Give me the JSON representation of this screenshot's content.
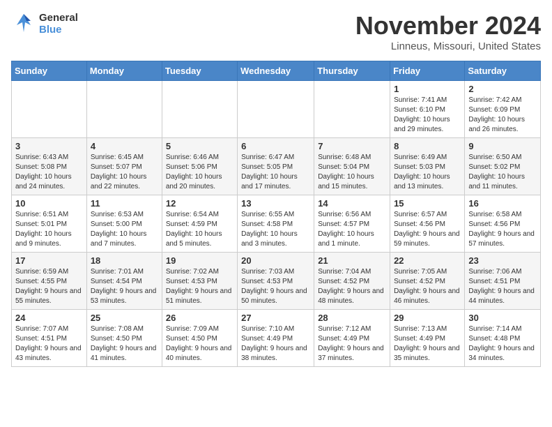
{
  "header": {
    "logo_general": "General",
    "logo_blue": "Blue",
    "month": "November 2024",
    "location": "Linneus, Missouri, United States"
  },
  "weekdays": [
    "Sunday",
    "Monday",
    "Tuesday",
    "Wednesday",
    "Thursday",
    "Friday",
    "Saturday"
  ],
  "weeks": [
    [
      {
        "day": "",
        "info": ""
      },
      {
        "day": "",
        "info": ""
      },
      {
        "day": "",
        "info": ""
      },
      {
        "day": "",
        "info": ""
      },
      {
        "day": "",
        "info": ""
      },
      {
        "day": "1",
        "info": "Sunrise: 7:41 AM\nSunset: 6:10 PM\nDaylight: 10 hours and 29 minutes."
      },
      {
        "day": "2",
        "info": "Sunrise: 7:42 AM\nSunset: 6:09 PM\nDaylight: 10 hours and 26 minutes."
      }
    ],
    [
      {
        "day": "3",
        "info": "Sunrise: 6:43 AM\nSunset: 5:08 PM\nDaylight: 10 hours and 24 minutes."
      },
      {
        "day": "4",
        "info": "Sunrise: 6:45 AM\nSunset: 5:07 PM\nDaylight: 10 hours and 22 minutes."
      },
      {
        "day": "5",
        "info": "Sunrise: 6:46 AM\nSunset: 5:06 PM\nDaylight: 10 hours and 20 minutes."
      },
      {
        "day": "6",
        "info": "Sunrise: 6:47 AM\nSunset: 5:05 PM\nDaylight: 10 hours and 17 minutes."
      },
      {
        "day": "7",
        "info": "Sunrise: 6:48 AM\nSunset: 5:04 PM\nDaylight: 10 hours and 15 minutes."
      },
      {
        "day": "8",
        "info": "Sunrise: 6:49 AM\nSunset: 5:03 PM\nDaylight: 10 hours and 13 minutes."
      },
      {
        "day": "9",
        "info": "Sunrise: 6:50 AM\nSunset: 5:02 PM\nDaylight: 10 hours and 11 minutes."
      }
    ],
    [
      {
        "day": "10",
        "info": "Sunrise: 6:51 AM\nSunset: 5:01 PM\nDaylight: 10 hours and 9 minutes."
      },
      {
        "day": "11",
        "info": "Sunrise: 6:53 AM\nSunset: 5:00 PM\nDaylight: 10 hours and 7 minutes."
      },
      {
        "day": "12",
        "info": "Sunrise: 6:54 AM\nSunset: 4:59 PM\nDaylight: 10 hours and 5 minutes."
      },
      {
        "day": "13",
        "info": "Sunrise: 6:55 AM\nSunset: 4:58 PM\nDaylight: 10 hours and 3 minutes."
      },
      {
        "day": "14",
        "info": "Sunrise: 6:56 AM\nSunset: 4:57 PM\nDaylight: 10 hours and 1 minute."
      },
      {
        "day": "15",
        "info": "Sunrise: 6:57 AM\nSunset: 4:56 PM\nDaylight: 9 hours and 59 minutes."
      },
      {
        "day": "16",
        "info": "Sunrise: 6:58 AM\nSunset: 4:56 PM\nDaylight: 9 hours and 57 minutes."
      }
    ],
    [
      {
        "day": "17",
        "info": "Sunrise: 6:59 AM\nSunset: 4:55 PM\nDaylight: 9 hours and 55 minutes."
      },
      {
        "day": "18",
        "info": "Sunrise: 7:01 AM\nSunset: 4:54 PM\nDaylight: 9 hours and 53 minutes."
      },
      {
        "day": "19",
        "info": "Sunrise: 7:02 AM\nSunset: 4:53 PM\nDaylight: 9 hours and 51 minutes."
      },
      {
        "day": "20",
        "info": "Sunrise: 7:03 AM\nSunset: 4:53 PM\nDaylight: 9 hours and 50 minutes."
      },
      {
        "day": "21",
        "info": "Sunrise: 7:04 AM\nSunset: 4:52 PM\nDaylight: 9 hours and 48 minutes."
      },
      {
        "day": "22",
        "info": "Sunrise: 7:05 AM\nSunset: 4:52 PM\nDaylight: 9 hours and 46 minutes."
      },
      {
        "day": "23",
        "info": "Sunrise: 7:06 AM\nSunset: 4:51 PM\nDaylight: 9 hours and 44 minutes."
      }
    ],
    [
      {
        "day": "24",
        "info": "Sunrise: 7:07 AM\nSunset: 4:51 PM\nDaylight: 9 hours and 43 minutes."
      },
      {
        "day": "25",
        "info": "Sunrise: 7:08 AM\nSunset: 4:50 PM\nDaylight: 9 hours and 41 minutes."
      },
      {
        "day": "26",
        "info": "Sunrise: 7:09 AM\nSunset: 4:50 PM\nDaylight: 9 hours and 40 minutes."
      },
      {
        "day": "27",
        "info": "Sunrise: 7:10 AM\nSunset: 4:49 PM\nDaylight: 9 hours and 38 minutes."
      },
      {
        "day": "28",
        "info": "Sunrise: 7:12 AM\nSunset: 4:49 PM\nDaylight: 9 hours and 37 minutes."
      },
      {
        "day": "29",
        "info": "Sunrise: 7:13 AM\nSunset: 4:49 PM\nDaylight: 9 hours and 35 minutes."
      },
      {
        "day": "30",
        "info": "Sunrise: 7:14 AM\nSunset: 4:48 PM\nDaylight: 9 hours and 34 minutes."
      }
    ]
  ]
}
